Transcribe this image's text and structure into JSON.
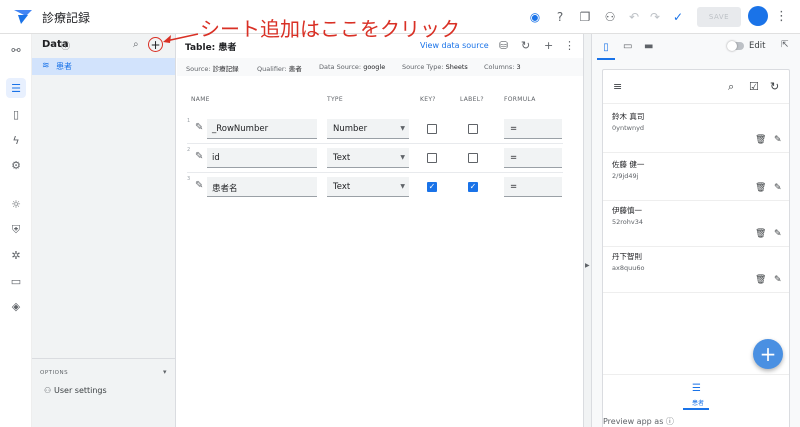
{
  "app": {
    "title": "診療記録"
  },
  "toolbar": {
    "save_label": "SAVE"
  },
  "data_panel": {
    "heading": "Data",
    "add_symbol": "+",
    "table_item": "患者",
    "options_label": "OPTIONS",
    "user_settings": "User settings"
  },
  "annotation": {
    "text": "シート追加はここをクリック"
  },
  "table": {
    "title": "Table: 患者",
    "view_source": "View data source",
    "source": {
      "source_label": "Source:",
      "source_value": "診療記録",
      "qualifier_label": "Qualifier:",
      "qualifier_value": "患者",
      "data_source_label": "Data Source:",
      "data_source_value": "google",
      "source_type_label": "Source Type:",
      "source_type_value": "Sheets",
      "columns_label": "Columns:",
      "columns_value": "3"
    },
    "headers": {
      "name": "NAME",
      "type": "TYPE",
      "key": "KEY?",
      "label": "LABEL?",
      "formula": "FORMULA"
    },
    "rows": [
      {
        "num": "1",
        "name": "_RowNumber",
        "type": "Number",
        "key": false,
        "label": false,
        "formula": "="
      },
      {
        "num": "2",
        "name": "id",
        "type": "Text",
        "key": false,
        "label": false,
        "formula": "="
      },
      {
        "num": "3",
        "name": "患者名",
        "type": "Text",
        "key": true,
        "label": true,
        "formula": "="
      }
    ]
  },
  "preview": {
    "edit_label": "Edit",
    "preview_as": "Preview app as",
    "records": [
      {
        "name": "鈴木 真司",
        "id": "0yntwnyd"
      },
      {
        "name": "佐藤 健一",
        "id": "2/9jd49j"
      },
      {
        "name": "伊藤慎一",
        "id": "52rohv34"
      },
      {
        "name": "丹下智則",
        "id": "ax8quu6o"
      }
    ],
    "fab_symbol": "+",
    "nav_label": "患者"
  },
  "colors": {
    "accent": "#1a73e8",
    "annotation": "#d93025"
  }
}
